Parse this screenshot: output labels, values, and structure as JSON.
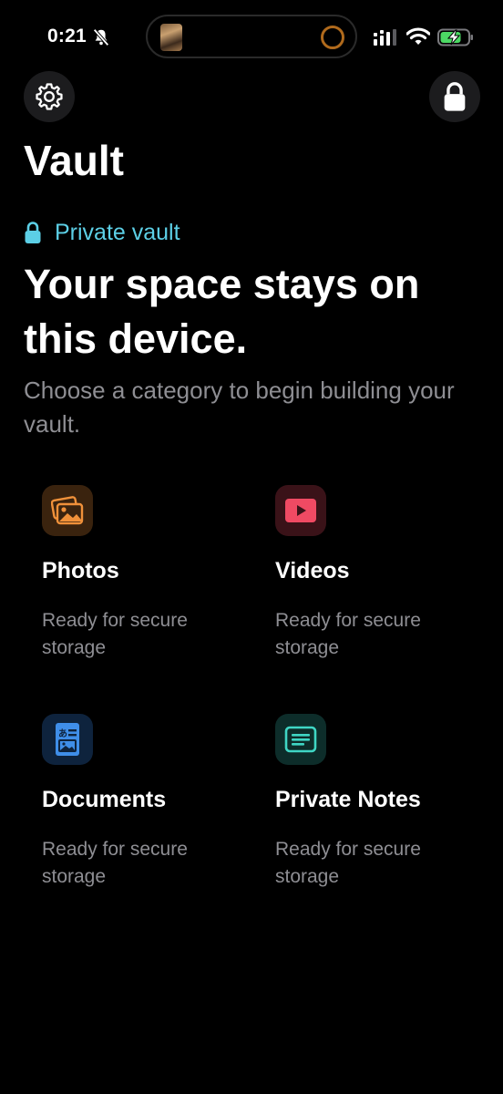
{
  "status_bar": {
    "time": "0:21",
    "icons": [
      "bell-slash-icon",
      "signal-icon",
      "wifi-icon",
      "battery-charging-icon"
    ]
  },
  "toolbar": {
    "settings_icon": "gear-icon",
    "lock_icon": "lock-icon"
  },
  "page": {
    "title": "Vault",
    "badge": "Private vault",
    "headline": "Your space stays on this device.",
    "subtitle": "Choose a category to begin building your vault."
  },
  "categories": [
    {
      "title": "Photos",
      "description": "Ready for secure storage",
      "icon": "photos-icon",
      "color": "#f0913a"
    },
    {
      "title": "Videos",
      "description": "Ready for secure storage",
      "icon": "play-icon",
      "color": "#ef4a63"
    },
    {
      "title": "Documents",
      "description": "Ready for secure storage",
      "icon": "document-icon",
      "color": "#3f8ee8"
    },
    {
      "title": "Private Notes",
      "description": "Ready for secure storage",
      "icon": "notes-icon",
      "color": "#3fd6c4"
    }
  ],
  "colors": {
    "background": "#000000",
    "accent": "#5ccfe6",
    "secondary_text": "#8e8e93",
    "button_bg": "#1c1c1e"
  }
}
